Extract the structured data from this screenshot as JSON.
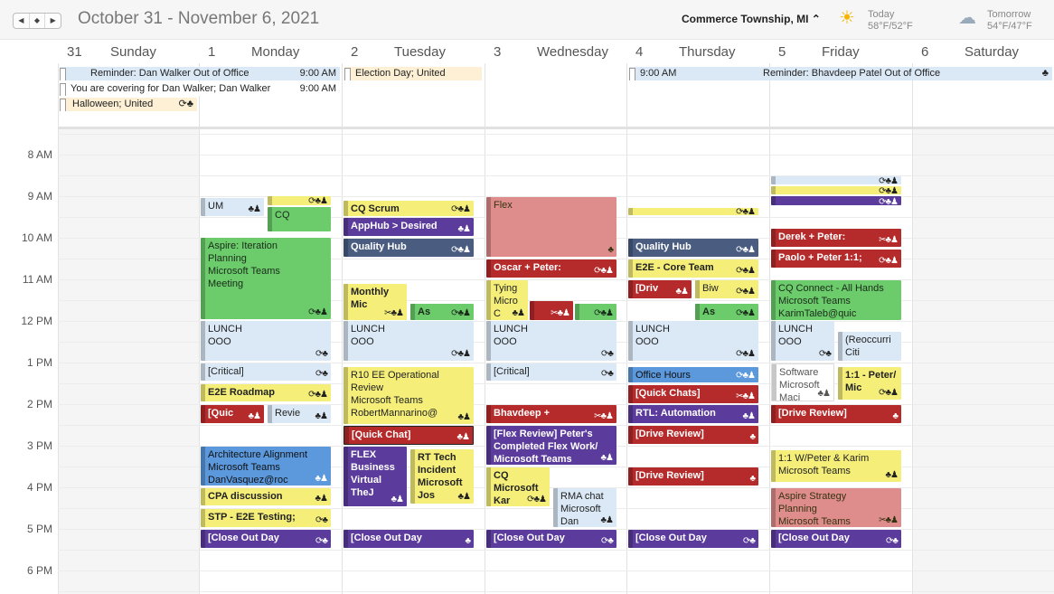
{
  "header": {
    "nav": [
      "◀",
      "◆",
      "▶"
    ],
    "range_title": "October 31 - November 6, 2021",
    "location": "Commerce Township, MI ⌃",
    "weather_today": {
      "label": "Today",
      "temp": "58°F/52°F",
      "icon": "sun-cloud-icon"
    },
    "weather_tomorrow": {
      "label": "Tomorrow",
      "temp": "54°F/47°F",
      "icon": "rain-cloud-icon"
    }
  },
  "days": [
    {
      "num": "31",
      "name": "Sunday"
    },
    {
      "num": "1",
      "name": "Monday"
    },
    {
      "num": "2",
      "name": "Tuesday"
    },
    {
      "num": "3",
      "name": "Wednesday"
    },
    {
      "num": "4",
      "name": "Thursday"
    },
    {
      "num": "5",
      "name": "Friday"
    },
    {
      "num": "6",
      "name": "Saturday"
    }
  ],
  "all_day": {
    "reminder_dan": {
      "title": "Reminder: Dan Walker Out of Office",
      "time": "9:00 AM"
    },
    "covering_dan": {
      "title": "You are covering for Dan Walker; Dan Walker",
      "time": "9:00 AM"
    },
    "halloween": {
      "title": "Halloween; United",
      "icons": "⟳♣"
    },
    "election": {
      "title": "Election Day; United"
    },
    "reminder_bhav": {
      "time": "9:00 AM",
      "title": "Reminder: Bhavdeep Patel Out of Office",
      "icons": "♣"
    }
  },
  "time_labels": [
    "8 AM",
    "9 AM",
    "10 AM",
    "11 AM",
    "12 PM",
    "1 PM",
    "2 PM",
    "3 PM",
    "4 PM",
    "5 PM",
    "6 PM"
  ],
  "events": {
    "mon": {
      "um": {
        "title": "UM",
        "icons": "♣♟"
      },
      "cq_top": {
        "title": "",
        "icons": "⟳♣♟"
      },
      "cq": {
        "title": "CQ"
      },
      "aspire": {
        "title": "Aspire: Iteration\nPlanning\nMicrosoft Teams\nMeeting",
        "icons": "⟳♣♟"
      },
      "lunch": {
        "title": "LUNCH\nOOO",
        "icons": "⟳♣"
      },
      "critical": {
        "title": "[Critical]",
        "icons": "⟳♣"
      },
      "e2e": {
        "title": "E2E Roadmap",
        "icons": "⟳♣♟"
      },
      "quic": {
        "title": "[Quic",
        "icons": "♣♟"
      },
      "revie": {
        "title": "Revie",
        "icons": "♣♟"
      },
      "arch": {
        "title": "Architecture Alignment\nMicrosoft Teams\nDanVasquez@roc",
        "icons": "♣♟"
      },
      "cpa": {
        "title": "CPA discussion",
        "icons": "♣♟"
      },
      "stp": {
        "title": "STP - E2E Testing;",
        "icons": "⟳♣"
      },
      "closeout": {
        "title": "[Close Out Day",
        "icons": "⟳♣"
      }
    },
    "tue": {
      "cqscrum": {
        "title": "CQ Scrum",
        "icons": "⟳♣♟"
      },
      "apphub": {
        "title": "AppHub > Desired",
        "icons": "♣♟"
      },
      "qhub": {
        "title": "Quality Hub",
        "icons": "⟳♣♟"
      },
      "monthly": {
        "title": "Monthly\nMic",
        "icons": "✂♣♟"
      },
      "as": {
        "title": "As",
        "icons": "⟳♣♟"
      },
      "lunch": {
        "title": "LUNCH\nOOO",
        "icons": "⟳♣♟"
      },
      "r10": {
        "title": "R10 EE Operational\nReview\nMicrosoft Teams\nRobertMannarino@",
        "icons": "♣♟"
      },
      "qchat": {
        "title": "[Quick Chat]",
        "icons": "♣♟"
      },
      "flex": {
        "title": "FLEX\nBusiness\nVirtual\nTheJ",
        "icons": "♣♟"
      },
      "rttech": {
        "title": "RT Tech\nIncident\nMicrosoft\nJos",
        "icons": "♣♟"
      },
      "closeout": {
        "title": "[Close Out Day",
        "icons": "♣"
      }
    },
    "wed": {
      "flex": {
        "title": "Flex",
        "icons": "♣"
      },
      "oscar": {
        "title": "Oscar + Peter:",
        "icons": "⟳♣♟"
      },
      "tying": {
        "title": "Tying\nMicro\nC",
        "icons": "♣♟"
      },
      "mid": {
        "title": "",
        "icons": "✂♣♟"
      },
      "green": {
        "title": "",
        "icons": "⟳♣♟"
      },
      "lunch": {
        "title": "LUNCH\nOOO",
        "icons": "⟳♣"
      },
      "critical": {
        "title": "[Critical]",
        "icons": "⟳♣"
      },
      "bhavdeep": {
        "title": "Bhavdeep +",
        "icons": "✂♣♟"
      },
      "flexreview": {
        "title": "[Flex Review] Peter's\nCompleted Flex Work/\nMicrosoft Teams",
        "icons": "♣♟"
      },
      "cq": {
        "title": "CQ\nMicrosoft\nKar",
        "icons": "⟳♣♟"
      },
      "rma": {
        "title": "RMA chat\nMicrosoft\nDan",
        "icons": "♣♟"
      },
      "closeout": {
        "title": "[Close Out Day",
        "icons": "⟳♣"
      }
    },
    "thu": {
      "top": {
        "title": "",
        "icons": "⟳♣♟"
      },
      "qhub": {
        "title": "Quality Hub",
        "icons": "⟳♣♟"
      },
      "e2e": {
        "title": "E2E - Core Team",
        "icons": "⟳♣♟"
      },
      "driv": {
        "title": "[Driv",
        "icons": "♣♟"
      },
      "biw": {
        "title": "Biw",
        "icons": "⟳♣♟"
      },
      "as": {
        "title": "As",
        "icons": "⟳♣♟"
      },
      "lunch": {
        "title": "LUNCH\nOOO",
        "icons": "⟳♣♟"
      },
      "office": {
        "title": "Office Hours",
        "icons": "⟳♣♟"
      },
      "qchats": {
        "title": "[Quick Chats]",
        "icons": "✂♣♟"
      },
      "rtl": {
        "title": "RTL: Automation",
        "icons": "♣♟"
      },
      "drive1": {
        "title": "[Drive Review]",
        "icons": "♣"
      },
      "drive2": {
        "title": "[Drive Review]",
        "icons": "♣"
      },
      "closeout": {
        "title": "[Close Out Day",
        "icons": "⟳♣"
      }
    },
    "fri": {
      "t1": {
        "title": "",
        "icons": "⟳♣♟"
      },
      "t2": {
        "title": "",
        "icons": "⟳♣♟"
      },
      "t3": {
        "title": "",
        "icons": "⟳♣♟"
      },
      "derek": {
        "title": "Derek + Peter:",
        "icons": "✂♣♟"
      },
      "paolo": {
        "title": "Paolo + Peter 1:1;",
        "icons": "⟳♣♟"
      },
      "cqconnect": {
        "title": "CQ Connect - All Hands\nMicrosoft Teams\nKarimTaleb@quic",
        "icons": ""
      },
      "lunch": {
        "title": "LUNCH\nOOO",
        "icons": "⟳♣"
      },
      "reocc": {
        "title": "(Reoccurri\nCiti",
        "icons": ""
      },
      "software": {
        "title": "Software\nMicrosoft\nMaci",
        "icons": "♣♟"
      },
      "peter11": {
        "title": "1:1 - Peter/\nMic",
        "icons": "⟳♣♟"
      },
      "drive": {
        "title": "[Drive Review]",
        "icons": "♣"
      },
      "peterkarim": {
        "title": "1:1 W/Peter & Karim\nMicrosoft Teams",
        "icons": "♣♟"
      },
      "aspire": {
        "title": "Aspire Strategy\nPlanning\nMicrosoft Teams",
        "icons": "✂♣♟"
      },
      "closeout": {
        "title": "[Close Out Day",
        "icons": "⟳♣"
      }
    }
  }
}
